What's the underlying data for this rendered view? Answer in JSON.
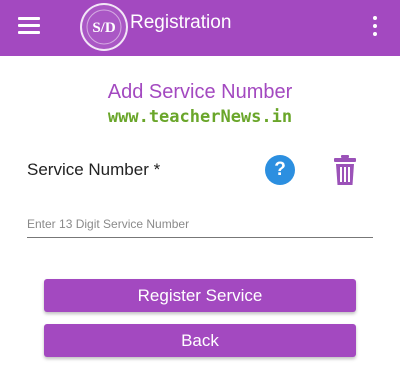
{
  "app_bar": {
    "title": "Registration",
    "logo_text": "S/D",
    "background_color": "#a349c0",
    "menu_icon": "hamburger-menu-icon",
    "overflow_icon": "more-vert-icon"
  },
  "form": {
    "heading": "Add Service Number",
    "heading_color": "#a349c0",
    "watermark": "www.teacherNews.in",
    "field_label": "Service Number *",
    "help_icon": "help-icon",
    "help_glyph": "?",
    "help_color": "#2c8fe0",
    "delete_icon": "trash-icon",
    "input_value": "",
    "input_placeholder": "Enter 13 Digit Service Number"
  },
  "buttons": {
    "register_label": "Register Service",
    "back_label": "Back",
    "color": "#a349c0"
  }
}
